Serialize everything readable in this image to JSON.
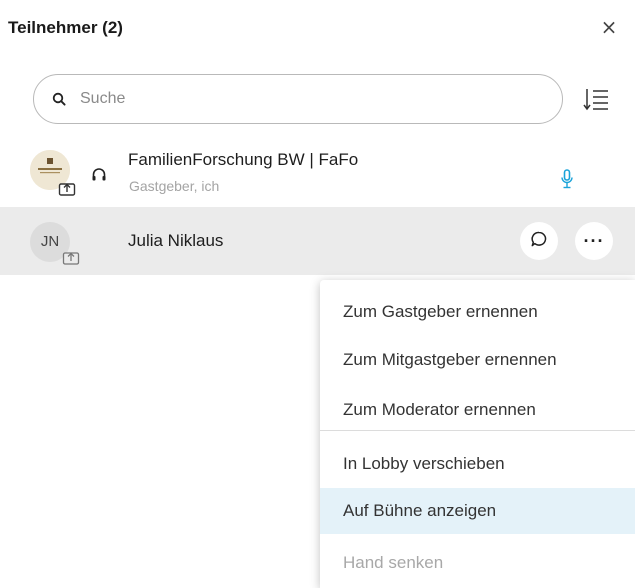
{
  "panel": {
    "title": "Teilnehmer (2)",
    "close_glyph": "×"
  },
  "search": {
    "placeholder": "Suche",
    "value": ""
  },
  "participants": [
    {
      "name": "FamilienForschung BW | FaFo",
      "subtitle": "Gastgeber, ich",
      "avatar": "org-logo",
      "icons": [
        "share-icon",
        "headset-icon",
        "microphone-icon"
      ]
    },
    {
      "name": "Julia Niklaus",
      "initials": "JN",
      "icons": [
        "share-icon",
        "chat-icon",
        "more-icon"
      ],
      "more_glyph": "···"
    }
  ],
  "context_menu": {
    "items": [
      {
        "label": "Zum Gastgeber ernennen",
        "state": "normal"
      },
      {
        "label": "Zum Mitgastgeber ernennen",
        "state": "normal"
      },
      {
        "label": "Zum Moderator ernennen",
        "state": "normal"
      },
      {
        "label": "In Lobby verschieben",
        "state": "normal"
      },
      {
        "label": "Auf Bühne anzeigen",
        "state": "highlighted"
      },
      {
        "label": "Hand senken",
        "state": "disabled"
      }
    ]
  },
  "colors": {
    "highlight": "#e4f2f9",
    "selected_row": "#ebebeb",
    "mic_accent": "#1aa3d9"
  }
}
